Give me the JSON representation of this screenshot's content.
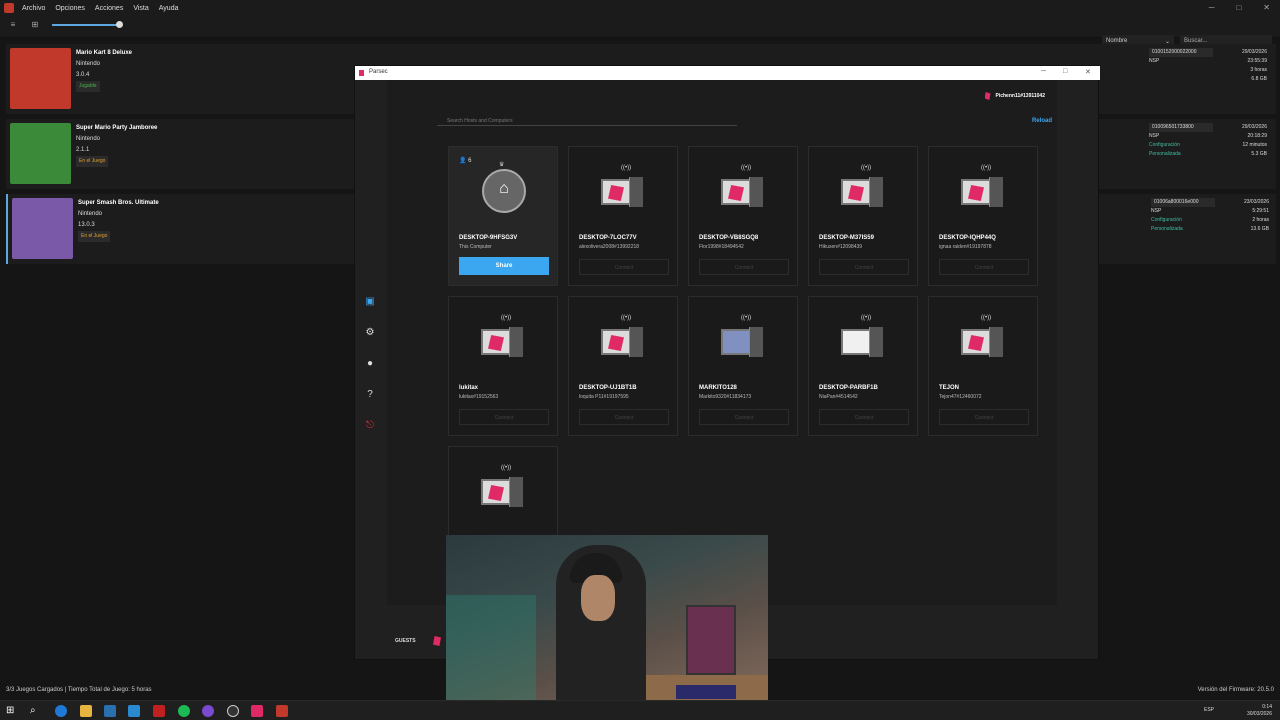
{
  "menubar": {
    "items": [
      "Archivo",
      "Opciones",
      "Acciones",
      "Vista",
      "Ayuda"
    ]
  },
  "toolbar": {
    "sort_label": "Nombre",
    "search_placeholder": "Buscar..."
  },
  "games": [
    {
      "title": "Mario Kart 8 Deluxe",
      "developer": "Nintendo",
      "version": "3.0.4",
      "status": "Jugable",
      "status_color": "#4caf50",
      "title_id": "0100152000022000",
      "format": "NSP",
      "config": "",
      "last_played_date": "29/03/2026",
      "last_played_time": "23:55:39",
      "play_time": "3 horas",
      "size": "6.8 GB",
      "thumb_color": "#c0392b"
    },
    {
      "title": "Super Mario Party Jamboree",
      "developer": "Nintendo",
      "version": "2.1.1",
      "status": "En el Juego",
      "status_color": "#e0a030",
      "title_id": "010096501733800",
      "format": "NSP",
      "config": "Configuración Personalizada",
      "last_played_date": "29/03/2026",
      "last_played_time": "20:18:29",
      "play_time": "12 minutos",
      "size": "5.3 GB",
      "thumb_color": "#3a8a3a"
    },
    {
      "title": "Super Smash Bros. Ultimate",
      "developer": "Nintendo",
      "version": "13.0.3",
      "status": "En el Juego",
      "status_color": "#e0a030",
      "title_id": "01006a800016e000",
      "format": "NSP",
      "config": "Configuración Personalizada",
      "last_played_date": "23/03/2026",
      "last_played_time": "5:29:51",
      "play_time": "2 horas",
      "size": "13.6 GB",
      "thumb_color": "#7a5aa8"
    }
  ],
  "statusbar": {
    "games_loaded": "3/3 Juegos Cargados | Tiempo Total de Juego: 5 horas",
    "firmware": "Versión del Firmware: 20.5.0"
  },
  "parsec": {
    "window_title": "Parsec",
    "user": "Pichenn11#13911042",
    "search_placeholder": "Search Hosts and Computers",
    "reload_label": "Reload",
    "guests_label": "GUESTS",
    "share_label": "Share",
    "connect_label": "Connect",
    "self_guest_count": "6",
    "hosts": [
      {
        "name": "DESKTOP-9HFSG3V",
        "sub": "This Computer",
        "self": true
      },
      {
        "name": "DESKTOP-7LOC77V",
        "sub": "alexolivera2008#13992218"
      },
      {
        "name": "DESKTOP-VB8SGQ8",
        "sub": "Flor1998#18494542"
      },
      {
        "name": "DESKTOP-M37IS59",
        "sub": "Hikusen#12098439"
      },
      {
        "name": "DESKTOP-IQHP44Q",
        "sub": "ignaa raiden#19197878"
      },
      {
        "name": "lukitax",
        "sub": "lukitax#19152563"
      },
      {
        "name": "DESKTOP-UJ1BT1B",
        "sub": "loquita P11#19197595"
      },
      {
        "name": "MARKITO128",
        "sub": "Markito9320#11834173"
      },
      {
        "name": "DESKTOP-PARBF1B",
        "sub": "NiaPan#4514542"
      },
      {
        "name": "TEJON",
        "sub": "Tejon47#12460072"
      }
    ]
  },
  "taskbar": {
    "language": "ESP",
    "time": "0:14",
    "date": "30/03/2026"
  },
  "colors": {
    "accent": "#3ba7f0",
    "parsec_brand": "#e02a66"
  }
}
